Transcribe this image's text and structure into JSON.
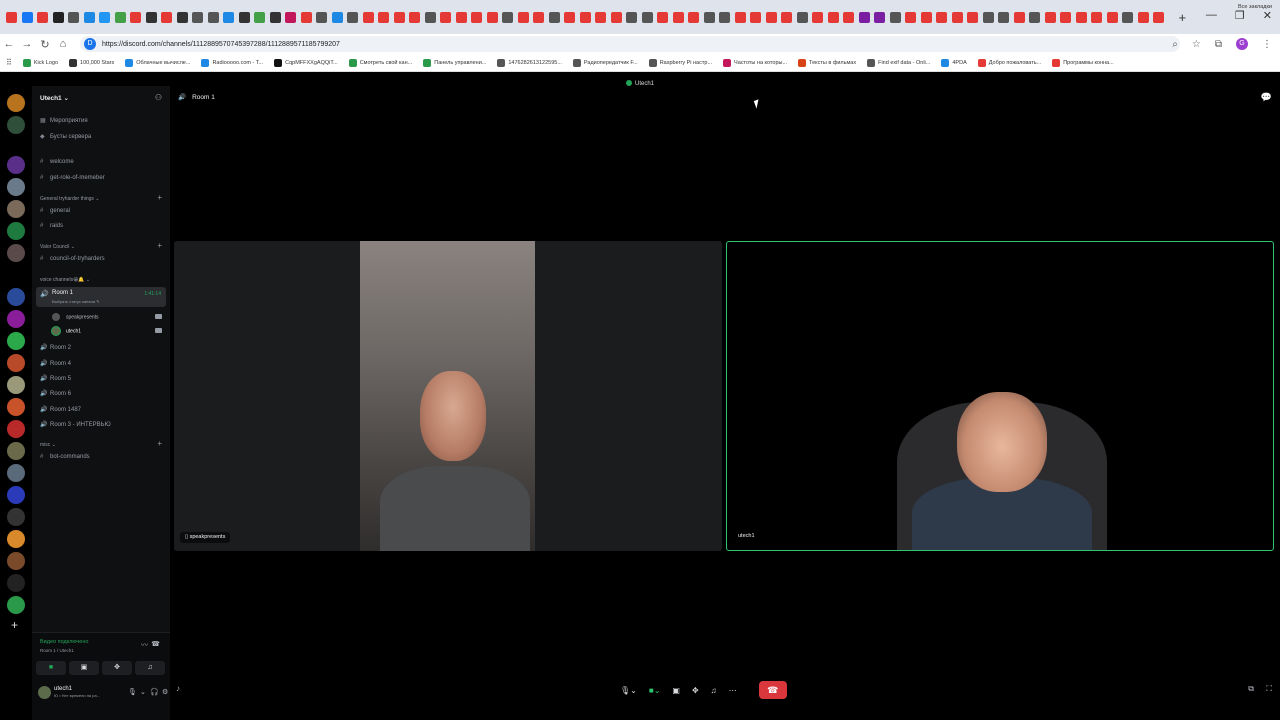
{
  "browser": {
    "url": "https://discord.com/channels/1112889570745397288/1112889571185799207",
    "bookmarks": [
      "Kick Logo",
      "100,000 Stars",
      "Облачные вычисле...",
      "Radiooooo.com - T...",
      "CqpMFFXXgAQQiT...",
      "Смотреть свой кан...",
      "Панель управлени...",
      "1476282613122595...",
      "Радиопередатчик F...",
      "Raspberry Pi настр...",
      "Частоты на которы...",
      "Тексты в фильмах",
      "Find exif data - Onli...",
      "4PDA",
      "Добро пожаловать...",
      "Программы конна..."
    ],
    "bookmarks_all": "Все закладки",
    "tab_icon_colors": [
      "#e53935",
      "#1877f2",
      "#e53935",
      "#222",
      "#555",
      "#1e88e5",
      "#2196f3",
      "#43a047",
      "#e53935",
      "#333",
      "#e53935",
      "#333",
      "#555",
      "#555",
      "#1e88e5",
      "#333",
      "#43a047",
      "#333",
      "#c2185b",
      "#e53935",
      "#555",
      "#1e88e5",
      "#555",
      "#e53935",
      "#e53935",
      "#e53935",
      "#e53935",
      "#555",
      "#e53935",
      "#e53935",
      "#e53935",
      "#e53935",
      "#555",
      "#e53935",
      "#e53935",
      "#555",
      "#e53935",
      "#e53935",
      "#e53935",
      "#e53935",
      "#555",
      "#555",
      "#e53935",
      "#e53935",
      "#e53935",
      "#555",
      "#555",
      "#e53935",
      "#e53935",
      "#e53935",
      "#e53935",
      "#555",
      "#e53935",
      "#e53935",
      "#e53935",
      "#7b1fa2",
      "#7b1fa2",
      "#555",
      "#e53935",
      "#e53935",
      "#e53935",
      "#e53935",
      "#e53935",
      "#555",
      "#555",
      "#e53935",
      "#555",
      "#e53935",
      "#e53935",
      "#e53935",
      "#e53935",
      "#e53935",
      "#555",
      "#e53935",
      "#e53935"
    ],
    "tab_add": "+",
    "profile_initial": "G"
  },
  "discord": {
    "window_title": "Utech1",
    "guild_name": "Utech1",
    "top_items": [
      {
        "icon": "calendar-icon",
        "label": "Мероприятия"
      },
      {
        "icon": "boost-icon",
        "label": "Бусты сервера"
      }
    ],
    "channels_top": [
      "welcome",
      "get-role-of-memeber"
    ],
    "categories": {
      "general": "General tryharder things",
      "valor": "Valor Council",
      "voice": "voice channels😀🔔",
      "misc": "misc"
    },
    "general_channels": [
      "general",
      "raids"
    ],
    "valor_channels": [
      "council-of-tryharders"
    ],
    "room1": {
      "name": "Room 1",
      "status": "Выбрать статус канала ✎",
      "timer": "1:41:14"
    },
    "members": [
      "speakpresents",
      "utech1"
    ],
    "voice_channels": [
      "Room 2",
      "Room 4",
      "Room 5",
      "Room 6",
      "Room 1487",
      "Room 3 - ИНТЕРВЬЮ"
    ],
    "misc_channels": [
      "bot-commands"
    ],
    "voice_panel": {
      "status": "Видео подключено",
      "room": "Room 1 / Utech1"
    },
    "user": {
      "name": "utech1",
      "status": "Ю • Нет времени на ра..."
    },
    "stage": {
      "title": "Room 1",
      "left_name": "speakpresents",
      "right_name": "utech1"
    },
    "accent_green": "#23a559",
    "danger_red": "#da373c"
  }
}
